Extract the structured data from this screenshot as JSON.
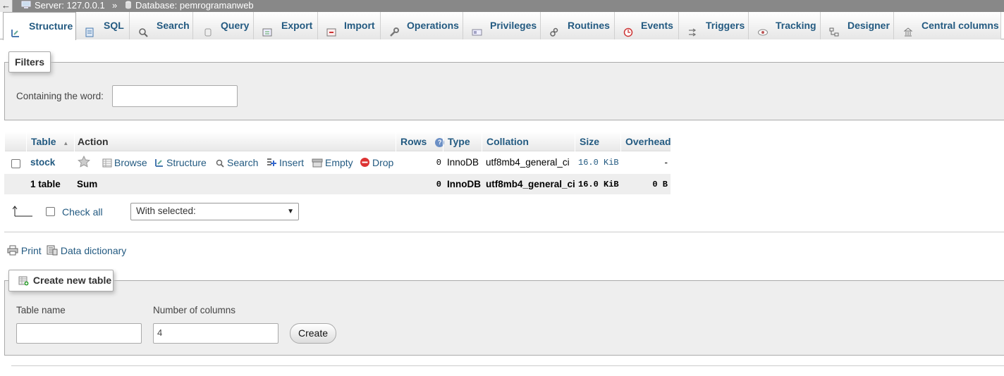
{
  "topbar": {
    "back_label": "←",
    "server": "Server: 127.0.0.1",
    "separator": "»",
    "database": "Database: pemrogramanweb"
  },
  "tabs": [
    {
      "label": "Structure",
      "icon": "structure-icon",
      "active": true
    },
    {
      "label": "SQL",
      "icon": "sql-icon"
    },
    {
      "label": "Search",
      "icon": "search-icon"
    },
    {
      "label": "Query",
      "icon": "query-icon"
    },
    {
      "label": "Export",
      "icon": "export-icon"
    },
    {
      "label": "Import",
      "icon": "import-icon"
    },
    {
      "label": "Operations",
      "icon": "wrench-icon"
    },
    {
      "label": "Privileges",
      "icon": "privileges-icon"
    },
    {
      "label": "Routines",
      "icon": "routines-icon"
    },
    {
      "label": "Events",
      "icon": "clock-icon"
    },
    {
      "label": "Triggers",
      "icon": "triggers-icon"
    },
    {
      "label": "Tracking",
      "icon": "eye-icon"
    },
    {
      "label": "Designer",
      "icon": "designer-icon"
    },
    {
      "label": "Central columns",
      "icon": "central-columns-icon"
    }
  ],
  "filters": {
    "legend": "Filters",
    "label": "Containing the word:",
    "value": ""
  },
  "table": {
    "headers": {
      "table": "Table",
      "sort_indicator": "▲",
      "action": "Action",
      "rows": "Rows",
      "help_icon_label": "?",
      "type": "Type",
      "collation": "Collation",
      "size": "Size",
      "overhead": "Overhead"
    },
    "rows": [
      {
        "name": "stock",
        "actions": {
          "browse": "Browse",
          "structure": "Structure",
          "search": "Search",
          "insert": "Insert",
          "empty": "Empty",
          "drop": "Drop"
        },
        "rows": "0",
        "type": "InnoDB",
        "collation": "utf8mb4_general_ci",
        "size": "16.0 KiB",
        "overhead": "-"
      }
    ],
    "summary": {
      "count": "1 table",
      "label": "Sum",
      "rows": "0",
      "type": "InnoDB",
      "collation": "utf8mb4_general_ci",
      "size": "16.0 KiB",
      "overhead": "0 B"
    }
  },
  "bulk": {
    "check_all": "Check all",
    "with_selected": "With selected:"
  },
  "links": {
    "print": "Print",
    "data_dictionary": "Data dictionary"
  },
  "create_table": {
    "legend": "Create new table",
    "name_label": "Table name",
    "name_value": "",
    "columns_label": "Number of columns",
    "columns_value": "4",
    "create_button": "Create"
  },
  "colors": {
    "link": "#235a81",
    "tab_bar_border": "#aaaaaa",
    "server_bar": "#888888",
    "drop_icon": "#d33333"
  }
}
